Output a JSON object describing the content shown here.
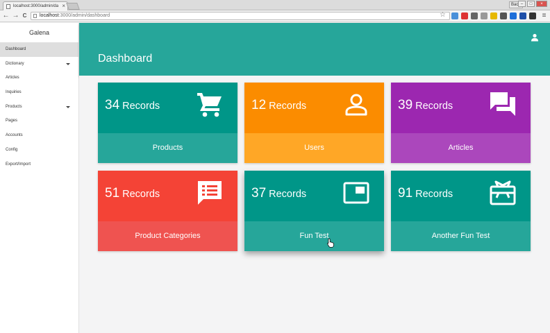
{
  "browser": {
    "tab_title": "localhost:3000/admin/da",
    "tab_close": "×",
    "url_host": "localhost",
    "url_path": ":3000/admin/dashboard",
    "user_label": "Вася",
    "back": "←",
    "forward": "→",
    "reload": "C",
    "menu": "≡",
    "minimize": "–",
    "maximize": "□",
    "close": "×",
    "bookmark_star": "☆"
  },
  "sidebar": {
    "brand": "Galena",
    "items": [
      {
        "label": "Dashboard",
        "active": true
      },
      {
        "label": "Dictionary",
        "dropdown": true
      },
      {
        "label": "Articles"
      },
      {
        "label": "Inquiries"
      },
      {
        "label": "Products",
        "dropdown": true
      },
      {
        "label": "Pages"
      },
      {
        "label": "Accounts"
      },
      {
        "label": "Config"
      },
      {
        "label": "Export/Import"
      }
    ]
  },
  "header": {
    "title": "Dashboard",
    "color": "#26a69a"
  },
  "cards": [
    {
      "count": "34",
      "unit": "Records",
      "label": "Products",
      "icon": "cart-icon",
      "top_color": "#009688",
      "bottom_color": "#26a69a"
    },
    {
      "count": "12",
      "unit": "Records",
      "label": "Users",
      "icon": "person-icon",
      "top_color": "#fb8c00",
      "bottom_color": "#ffa726"
    },
    {
      "count": "39",
      "unit": "Records",
      "label": "Articles",
      "icon": "chat-icon",
      "top_color": "#9c27b0",
      "bottom_color": "#ab47bc"
    },
    {
      "count": "51",
      "unit": "Records",
      "label": "Product Categories",
      "icon": "list-message-icon",
      "top_color": "#f44336",
      "bottom_color": "#ef5350"
    },
    {
      "count": "37",
      "unit": "Records",
      "label": "Fun Test",
      "icon": "picture-in-picture-icon",
      "top_color": "#009688",
      "bottom_color": "#26a69a"
    },
    {
      "count": "91",
      "unit": "Records",
      "label": "Another Fun Test",
      "icon": "gift-card-icon",
      "top_color": "#009688",
      "bottom_color": "#26a69a"
    }
  ]
}
